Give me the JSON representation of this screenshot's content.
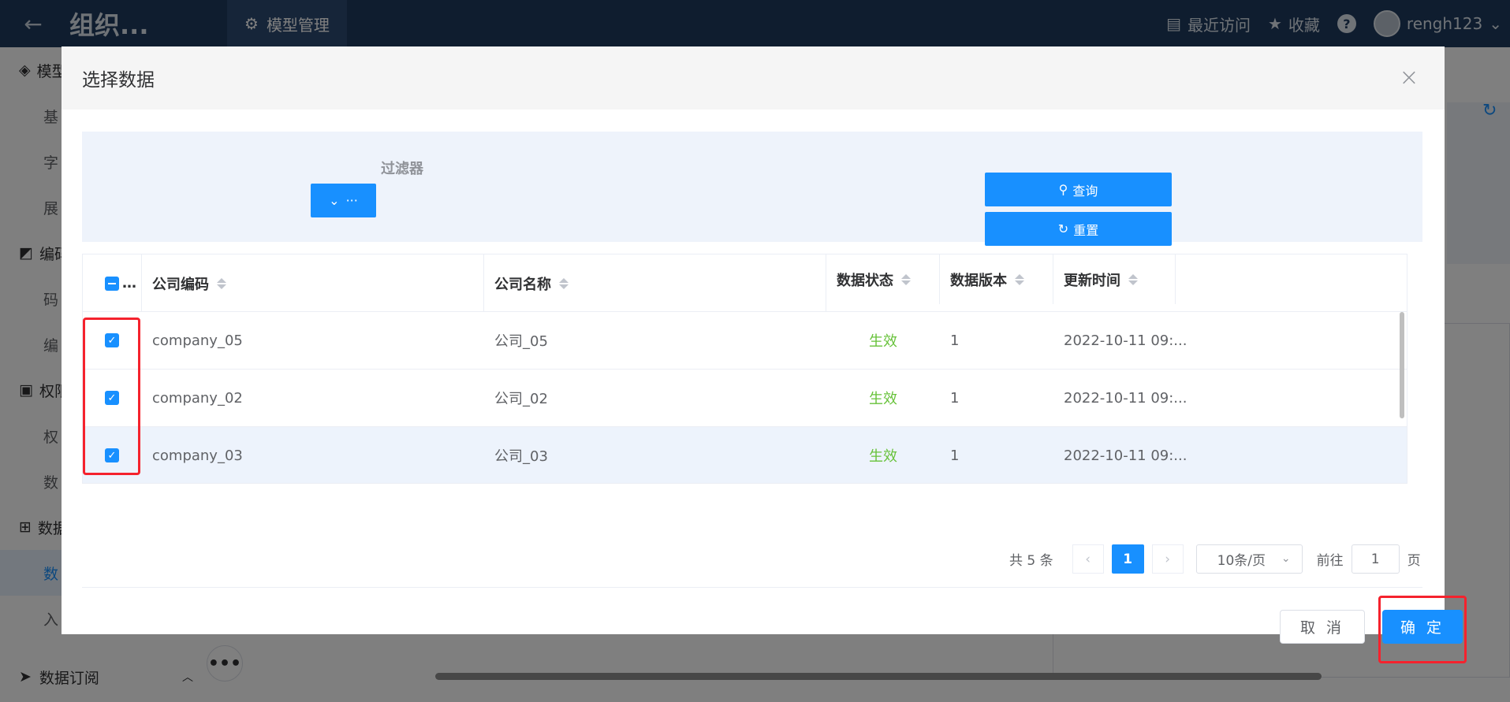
{
  "topbar": {
    "back_icon": "arrow-left-icon",
    "app_title": "组织...",
    "nav_active": "模型管理",
    "recent": "最近访问",
    "favorites": "收藏",
    "help": "?",
    "username": "rengh123"
  },
  "sidebar": {
    "groups": [
      {
        "label": "模型",
        "items": [
          "基",
          "字",
          "展"
        ]
      },
      {
        "label": "编码",
        "items": [
          "码",
          "编"
        ]
      },
      {
        "label": "权限",
        "items": [
          "权",
          "数"
        ]
      },
      {
        "label": "数据",
        "items": [
          "数",
          "入"
        ]
      }
    ],
    "bottom_label": "数据订阅"
  },
  "dialog": {
    "title": "选择数据",
    "close": "×",
    "filter_label": "过滤器",
    "filter_button": "···",
    "query_button": "查询",
    "reset_button": "重置",
    "columns": [
      "…",
      "公司编码",
      "公司名称",
      "数据状态",
      "数据版本",
      "更新时间"
    ],
    "rows": [
      {
        "code": "company_05",
        "name": "公司_05",
        "status": "生效",
        "version": "1",
        "updated": "2022-10-11 09:..."
      },
      {
        "code": "company_02",
        "name": "公司_02",
        "status": "生效",
        "version": "1",
        "updated": "2022-10-11 09:..."
      },
      {
        "code": "company_03",
        "name": "公司_03",
        "status": "生效",
        "version": "1",
        "updated": "2022-10-11 09:..."
      }
    ],
    "pagination": {
      "total": "共 5 条",
      "current_page": "1",
      "page_size": "10条/页",
      "goto_label": "前往",
      "goto_value": "1",
      "page_suffix": "页"
    },
    "cancel_button": "取 消",
    "confirm_button": "确 定"
  },
  "colors": {
    "primary": "#1890ff",
    "status_active": "#67c23a",
    "highlight_border": "#f5222d",
    "topbar": "#1e3a5f"
  }
}
